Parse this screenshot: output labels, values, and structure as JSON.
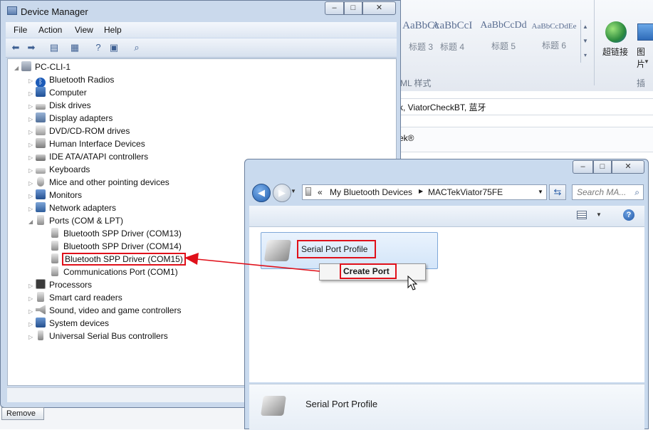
{
  "word": {
    "styles": [
      {
        "sample": "AaBbCc",
        "name": "标题 3"
      },
      {
        "sample": "AaBbCcI",
        "name": "标题 4"
      },
      {
        "sample": "AaBbCcDd",
        "name": "标题 5"
      },
      {
        "sample": "AaBbCcDdEe",
        "name": "标题 6"
      }
    ],
    "link_label": "超链接",
    "picture_label": "图片",
    "group_label": "ML 样式",
    "insert_label": "插入",
    "doc_line1": "k, ViatorCheckBT, 蓝牙",
    "doc_line2": "ek®"
  },
  "device_manager": {
    "title": "Device Manager",
    "menus": [
      "File",
      "Action",
      "View",
      "Help"
    ],
    "root": "PC-CLI-1",
    "categories": [
      {
        "label": "Bluetooth Radios",
        "icon": "bluetooth-icon"
      },
      {
        "label": "Computer",
        "icon": "computer-icon"
      },
      {
        "label": "Disk drives",
        "icon": "disk-drive-icon"
      },
      {
        "label": "Display adapters",
        "icon": "display-adapter-icon"
      },
      {
        "label": "DVD/CD-ROM drives",
        "icon": "dvd-drive-icon"
      },
      {
        "label": "Human Interface Devices",
        "icon": "hid-icon"
      },
      {
        "label": "IDE ATA/ATAPI controllers",
        "icon": "ide-controller-icon"
      },
      {
        "label": "Keyboards",
        "icon": "keyboard-icon"
      },
      {
        "label": "Mice and other pointing devices",
        "icon": "mouse-icon"
      },
      {
        "label": "Monitors",
        "icon": "monitor-icon"
      },
      {
        "label": "Network adapters",
        "icon": "network-adapter-icon"
      },
      {
        "label": "Ports (COM & LPT)",
        "icon": "port-icon"
      }
    ],
    "ports": [
      "Bluetooth SPP Driver (COM13)",
      "Bluetooth SPP Driver (COM14)",
      "Bluetooth SPP Driver (COM15)",
      "Communications Port (COM1)"
    ],
    "categories_after": [
      {
        "label": "Processors",
        "icon": "processor-icon"
      },
      {
        "label": "Smart card readers",
        "icon": "smart-card-icon"
      },
      {
        "label": "Sound, video and game controllers",
        "icon": "sound-icon"
      },
      {
        "label": "System devices",
        "icon": "system-devices-icon"
      },
      {
        "label": "Universal Serial Bus controllers",
        "icon": "usb-icon"
      }
    ],
    "remove_label": "Remove"
  },
  "bluetooth_window": {
    "breadcrumb": [
      "My Bluetooth Devices",
      "MACTekViator75FE"
    ],
    "breadcrumb_prefix": "«",
    "search_placeholder": "Search MA...",
    "profile_label": "Serial Port Profile",
    "context_menu": [
      "Create Port"
    ],
    "details_label": "Serial Port Profile"
  },
  "colors": {
    "highlight": "#e0101a",
    "window_frame": "#c9daee"
  }
}
